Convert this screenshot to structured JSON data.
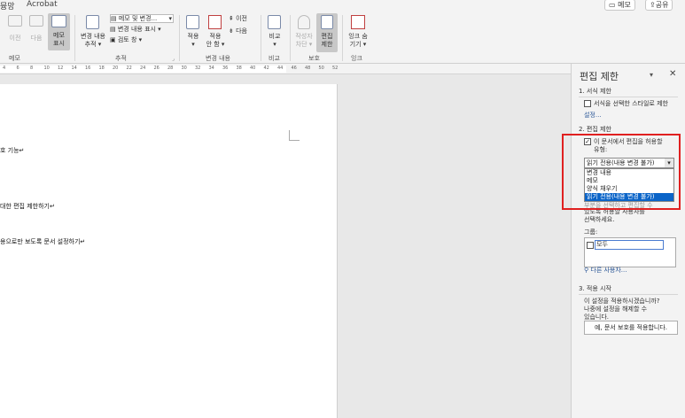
{
  "tabs": {
    "first": "뮹망",
    "acrobat": "Acrobat"
  },
  "top_buttons": {
    "memo": "메모",
    "share": "공유"
  },
  "ribbon": {
    "comments": {
      "prev": "이전",
      "next": "다음",
      "show_l1": "메모",
      "show_l2": "표시",
      "group": "메모"
    },
    "tracking": {
      "track_l1": "변경 내용",
      "track_l2": "추적",
      "markup": "메모 및 변경...",
      "show_markup": "변경 내용 표시",
      "review_pane": "검토 창",
      "group": "추적"
    },
    "changes": {
      "accept": "적용",
      "reject_l1": "적용",
      "reject_l2": "안 함",
      "prev": "이전",
      "next": "다음",
      "group": "변경 내용"
    },
    "compare": {
      "label": "비교",
      "group": "비교"
    },
    "protect": {
      "block_l1": "작성자",
      "block_l2": "차단",
      "restrict_l1": "편집",
      "restrict_l2": "제한",
      "group": "보호"
    },
    "ink": {
      "label_l1": "잉크 숨",
      "label_l2": "기기",
      "group": "잉크"
    }
  },
  "ruler": {
    "ticks": [
      "4",
      "6",
      "8",
      "10",
      "12",
      "14",
      "16",
      "18",
      "20",
      "22",
      "24",
      "26",
      "28",
      "30",
      "32",
      "34",
      "36",
      "38",
      "40",
      "42",
      "44",
      "46",
      "48",
      "50",
      "52"
    ]
  },
  "document": {
    "lines": [
      "호 기능↵",
      "대한 편집 제한하기↵",
      "용으로만 보도록 문서 설정하기↵"
    ]
  },
  "pane": {
    "title": "편집 제한",
    "s1": {
      "heading": "1. 서식 제한",
      "checkbox": "서식을 선택한 스타일로 제한",
      "settings_link": "설정..."
    },
    "s2": {
      "heading": "2. 편집 제한",
      "checkbox_l1": "이 문서에서 편집을 허용할",
      "checkbox_l2": "유형:",
      "select_value": "읽기 전용(내용 변경 불가)",
      "options": [
        "변경 내용",
        "메모",
        "양식 채우기",
        "읽기 전용(내용 변경 불가)"
      ],
      "hidden_text": "부분을 선택하고 편집할 수",
      "desc_l1": "있도록 허용할 사용자를",
      "desc_l2": "선택하세요.",
      "groups_label": "그룹:",
      "everyone": "모두",
      "more_users": "다른 사용자..."
    },
    "s3": {
      "heading": "3. 적용 시작",
      "desc_l1": "이 설정을 적용하시겠습니까?",
      "desc_l2": "나중에 설정을 해제할 수",
      "desc_l3": "있습니다.",
      "button": "예, 문서 보호를 적용합니다."
    }
  },
  "colors": {
    "highlight_box": "#e02020",
    "selection": "#0a64c8"
  }
}
